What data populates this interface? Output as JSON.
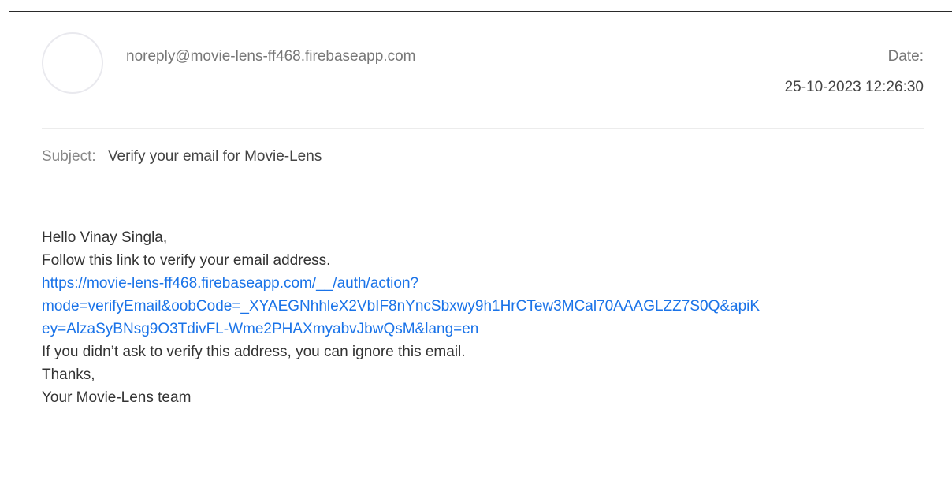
{
  "email": {
    "sender": "noreply@movie-lens-ff468.firebaseapp.com",
    "date_label": "Date:",
    "date_value": "25-10-2023 12:26:30",
    "subject_label": "Subject:",
    "subject": "Verify your email for Movie-Lens",
    "body": {
      "greeting": "Hello Vinay Singla,",
      "instruction": "Follow this link to verify your email address.",
      "link_lines": [
        "https://movie-lens-ff468.firebaseapp.com/__/auth/action?",
        "mode=verifyEmail&oobCode=_XYAEGNhhleX2VbIF8nYncSbxwy9h1HrCTew3MCal70AAAGLZZ7S0Q&apiK",
        "ey=AlzaSyBNsg9O3TdivFL-Wme2PHAXmyabvJbwQsM&lang=en"
      ],
      "ignore_note": "If you didn’t ask to verify this address, you can ignore this email.",
      "thanks": "Thanks,",
      "signature": "Your Movie-Lens team"
    }
  },
  "colors": {
    "link": "#1a73e8",
    "muted_text": "#777777",
    "body_text": "#333333"
  }
}
